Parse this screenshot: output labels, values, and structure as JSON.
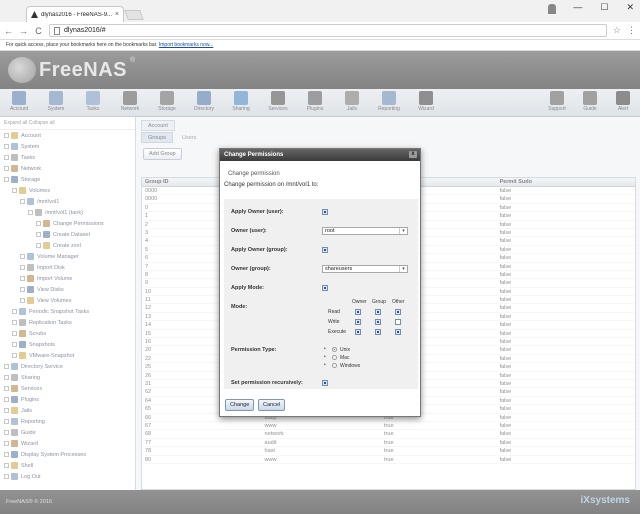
{
  "browser": {
    "tab_title": "dlynas2016 - FreeNAS-9...",
    "tab_close": "×",
    "window_controls": [
      "—",
      "☐",
      "✕"
    ],
    "back": "←",
    "forward": "→",
    "reload": "C",
    "address": "dlynas2016/#",
    "bookmarks_text": "For quick access, place your bookmarks here on the bookmarks bar.",
    "bookmarks_link": "Import bookmarks now..."
  },
  "header": {
    "logo_text": "FreeNAS",
    "logo_reg": "®"
  },
  "toolbar": {
    "items": [
      {
        "label": "Account",
        "color": "#4a6fa5"
      },
      {
        "label": "System",
        "color": "#5b7fae"
      },
      {
        "label": "Tasks",
        "color": "#6c8fb8"
      },
      {
        "label": "Network",
        "color": "#4b4b4b"
      },
      {
        "label": "Storage",
        "color": "#5a5a5a"
      },
      {
        "label": "Directory",
        "color": "#3f6a9e"
      },
      {
        "label": "Sharing",
        "color": "#3a7ab8"
      },
      {
        "label": "Services",
        "color": "#404040"
      },
      {
        "label": "Plugins",
        "color": "#4d4d4d"
      },
      {
        "label": "Jails",
        "color": "#6a6a6a"
      },
      {
        "label": "Reporting",
        "color": "#5a7eaa"
      },
      {
        "label": "Wizard",
        "color": "#333333"
      },
      {
        "label": "Support",
        "color": "#555555"
      },
      {
        "label": "Guide",
        "color": "#555555"
      },
      {
        "label": "Alert",
        "color": "#2f2f2f"
      }
    ]
  },
  "tree": {
    "top": "Expand all  Collapse all",
    "nodes": [
      {
        "label": "Account",
        "indent": 0
      },
      {
        "label": "System",
        "indent": 0
      },
      {
        "label": "Tasks",
        "indent": 0
      },
      {
        "label": "Network",
        "indent": 0
      },
      {
        "label": "Storage",
        "indent": 0
      },
      {
        "label": "Volumes",
        "indent": 1
      },
      {
        "label": "/mnt/vol1",
        "indent": 2
      },
      {
        "label": "/mnt/vol1 (tank)",
        "indent": 3
      },
      {
        "label": "Change Permissions",
        "indent": 4
      },
      {
        "label": "Create Dataset",
        "indent": 4
      },
      {
        "label": "Create zvol",
        "indent": 4
      },
      {
        "label": "Volume Manager",
        "indent": 2
      },
      {
        "label": "Import Disk",
        "indent": 2
      },
      {
        "label": "Import Volume",
        "indent": 2
      },
      {
        "label": "View Disks",
        "indent": 2
      },
      {
        "label": "View Volumes",
        "indent": 2
      },
      {
        "label": "Periodic Snapshot Tasks",
        "indent": 1
      },
      {
        "label": "Replication Tasks",
        "indent": 1
      },
      {
        "label": "Scrubs",
        "indent": 1
      },
      {
        "label": "Snapshots",
        "indent": 1
      },
      {
        "label": "VMware-Snapshot",
        "indent": 1
      },
      {
        "label": "Directory Service",
        "indent": 0
      },
      {
        "label": "Sharing",
        "indent": 0
      },
      {
        "label": "Services",
        "indent": 0
      },
      {
        "label": "Plugins",
        "indent": 0
      },
      {
        "label": "Jails",
        "indent": 0
      },
      {
        "label": "Reporting",
        "indent": 0
      },
      {
        "label": "Guide",
        "indent": 0
      },
      {
        "label": "Wizard",
        "indent": 0
      },
      {
        "label": "Display System Processes",
        "indent": 0
      },
      {
        "label": "Shell",
        "indent": 0
      },
      {
        "label": "Log Out",
        "indent": 0
      }
    ]
  },
  "main": {
    "tabs": [
      "Account"
    ],
    "subtabs": [
      "Groups",
      "Users"
    ],
    "add_group": "Add Group",
    "columns": [
      "Group ID",
      "",
      "",
      "Permit Sudo"
    ],
    "rows": [
      [
        "0000",
        "",
        "",
        "false"
      ],
      [
        "0000",
        "",
        "",
        "false"
      ],
      [
        "0",
        "",
        "",
        "false"
      ],
      [
        "1",
        "",
        "",
        "false"
      ],
      [
        "2",
        "",
        "",
        "false"
      ],
      [
        "3",
        "",
        "",
        "false"
      ],
      [
        "4",
        "",
        "",
        "false"
      ],
      [
        "5",
        "",
        "",
        "false"
      ],
      [
        "6",
        "",
        "",
        "false"
      ],
      [
        "7",
        "",
        "",
        "false"
      ],
      [
        "8",
        "",
        "",
        "false"
      ],
      [
        "9",
        "",
        "",
        "false"
      ],
      [
        "10",
        "",
        "",
        "false"
      ],
      [
        "11",
        "",
        "",
        "false"
      ],
      [
        "12",
        "",
        "",
        "false"
      ],
      [
        "13",
        "",
        "",
        "false"
      ],
      [
        "14",
        "",
        "",
        "false"
      ],
      [
        "15",
        "",
        "",
        "false"
      ],
      [
        "16",
        "",
        "",
        "false"
      ],
      [
        "20",
        "",
        "",
        "false"
      ],
      [
        "22",
        "",
        "",
        "false"
      ],
      [
        "25",
        "",
        "",
        "false"
      ],
      [
        "26",
        "",
        "",
        "false"
      ],
      [
        "31",
        "",
        "",
        "false"
      ],
      [
        "62",
        "",
        "",
        "false"
      ],
      [
        "64",
        "",
        "",
        "false"
      ],
      [
        "65",
        "_dhcp",
        "true",
        "false"
      ],
      [
        "66",
        "uucp",
        "true",
        "false"
      ],
      [
        "67",
        "www",
        "true",
        "false"
      ],
      [
        "68",
        "network",
        "true",
        "false"
      ],
      [
        "77",
        "audit",
        "true",
        "false"
      ],
      [
        "78",
        "hast",
        "true",
        "false"
      ],
      [
        "80",
        "www",
        "true",
        "false"
      ]
    ]
  },
  "dialog": {
    "title": "Change Permissions",
    "close": "x",
    "subtitle": "Change permission",
    "line": "Change permission on /mnt/vol1 to:",
    "apply_owner_user": "Apply Owner (user):",
    "owner_user": "Owner (user):",
    "owner_user_value": "root",
    "apply_owner_group": "Apply Owner (group):",
    "owner_group": "Owner (group):",
    "owner_group_value": "shareusers",
    "apply_mode": "Apply Mode:",
    "mode": "Mode:",
    "mode_cols": [
      "Owner",
      "Group",
      "Other"
    ],
    "mode_rows": [
      "Read",
      "Write",
      "Execute"
    ],
    "perm_type": "Permission Type:",
    "perm_options": [
      "Unix",
      "Mac",
      "Windows"
    ],
    "recursive": "Set permission recursively:",
    "change_btn": "Change",
    "cancel_btn": "Cancel"
  },
  "footer": {
    "copyright": "FreeNAS® © 2016",
    "brand": "iXsystems"
  }
}
